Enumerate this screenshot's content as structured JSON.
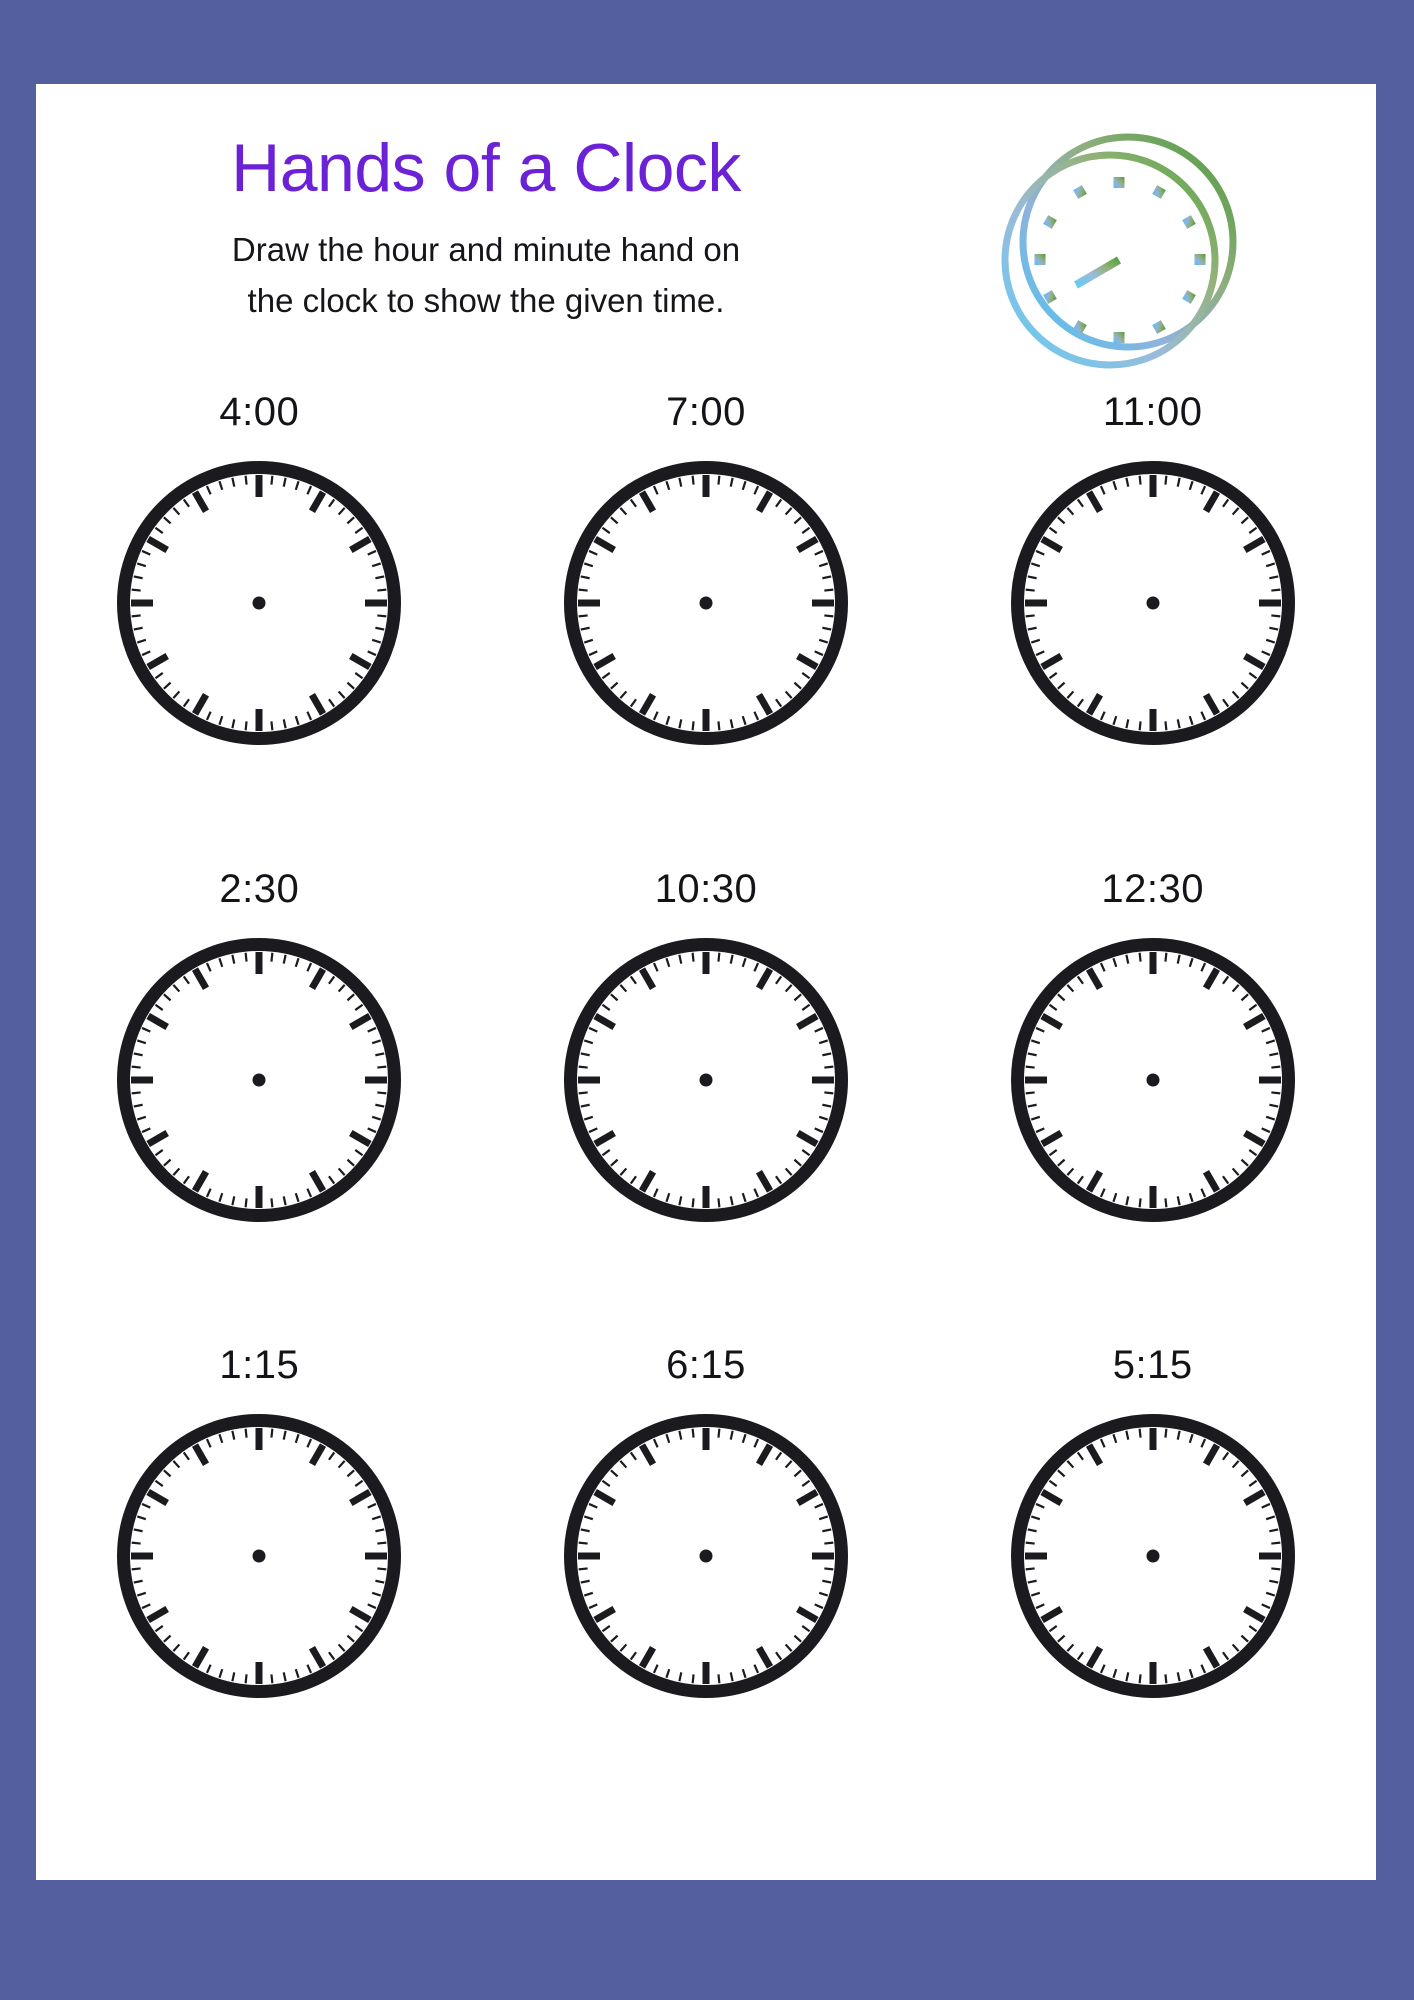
{
  "page": {
    "title": "Hands of a Clock",
    "instruction_line_1": "Draw the hour and minute hand on",
    "instruction_line_2": "the clock to show the given time.",
    "border_color": "#545FA0",
    "page_background": "#FFFFFF",
    "title_color": "#6B21D6",
    "text_color": "#16161a"
  },
  "logo": {
    "name": "decorative-clock-logo",
    "gradient_from": "#4FB3E8",
    "gradient_to": "#4E9B3C",
    "displayed_hour_angle_deg": 240,
    "displayed_minute_angle_deg": 0,
    "displayed_time": "8:00",
    "ring_count": 2,
    "hour_marker_count": 12,
    "marker_shape": "square"
  },
  "clock_style": {
    "rim_color": "#1B1B1F",
    "face_color": "#FFFFFF",
    "tick_color": "#1B1B1F",
    "center_dot_color": "#1B1B1F",
    "hour_marks": 12,
    "minute_ticks": 60,
    "hands_drawn": false
  },
  "exercises": [
    {
      "index": 1,
      "time": "4:00",
      "hour": 4,
      "minute": 0
    },
    {
      "index": 2,
      "time": "7:00",
      "hour": 7,
      "minute": 0
    },
    {
      "index": 3,
      "time": "11:00",
      "hour": 11,
      "minute": 0
    },
    {
      "index": 4,
      "time": "2:30",
      "hour": 2,
      "minute": 30
    },
    {
      "index": 5,
      "time": "10:30",
      "hour": 10,
      "minute": 30
    },
    {
      "index": 6,
      "time": "12:30",
      "hour": 12,
      "minute": 30
    },
    {
      "index": 7,
      "time": "1:15",
      "hour": 1,
      "minute": 15
    },
    {
      "index": 8,
      "time": "6:15",
      "hour": 6,
      "minute": 15
    },
    {
      "index": 9,
      "time": "5:15",
      "hour": 5,
      "minute": 15
    }
  ]
}
